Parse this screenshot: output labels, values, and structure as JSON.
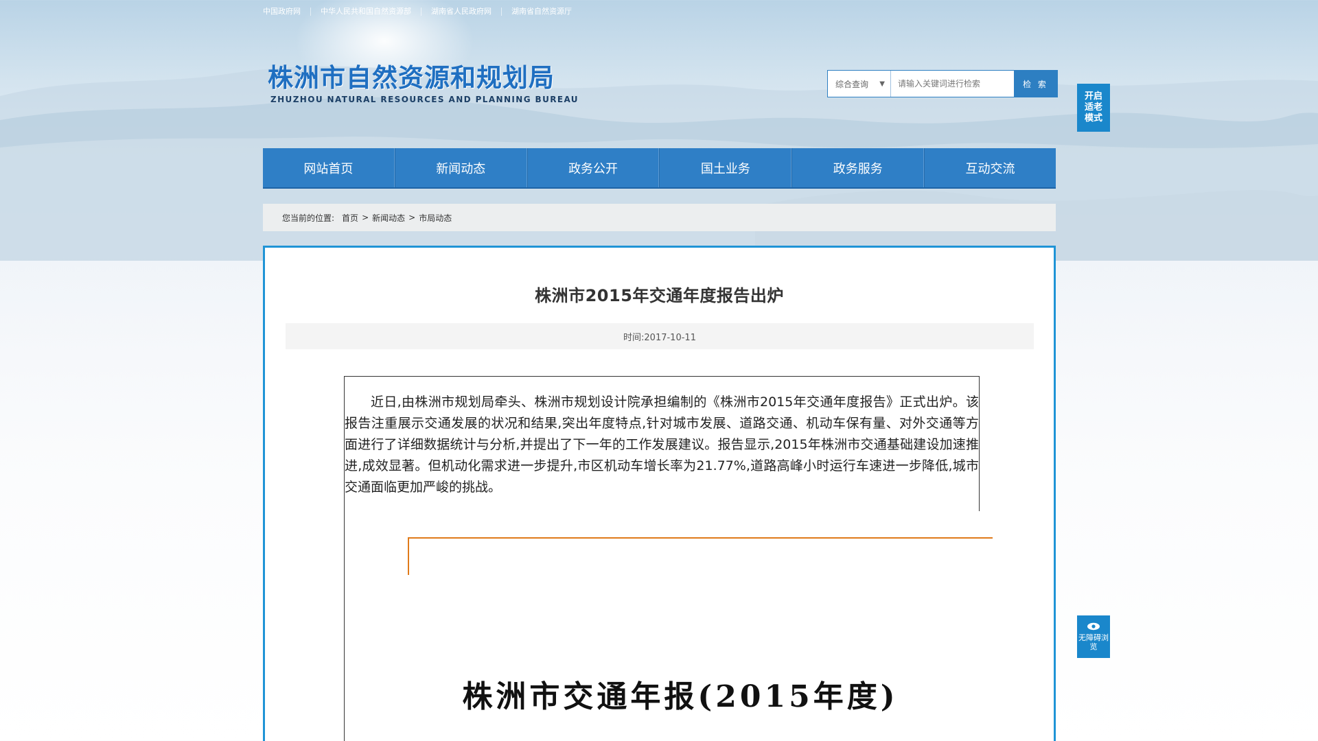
{
  "top_links": [
    {
      "label": "中国政府网"
    },
    {
      "label": "中华人民共和国自然资源部"
    },
    {
      "label": "湖南省人民政府网"
    },
    {
      "label": "湖南省自然资源厅"
    }
  ],
  "header": {
    "logo_cn": "株洲市自然资源和规划局",
    "logo_en": "ZHUZHOU NATURAL RESOURCES AND PLANNING BUREAU"
  },
  "search": {
    "select_value": "综合查询",
    "placeholder": "请输入关键词进行检索",
    "button_label": "检 索"
  },
  "side_buttons": {
    "elder_mode": "开启适老模式",
    "accessibility": "无障碍浏览",
    "accessibility_icon": "eye-icon"
  },
  "nav": {
    "items": [
      {
        "label": "网站首页"
      },
      {
        "label": "新闻动态"
      },
      {
        "label": "政务公开"
      },
      {
        "label": "国土业务"
      },
      {
        "label": "政务服务"
      },
      {
        "label": "互动交流"
      }
    ]
  },
  "breadcrumb": {
    "label": "您当前的位置:",
    "items": [
      "首页",
      "新闻动态",
      "市局动态"
    ],
    "separator": ">"
  },
  "article": {
    "title": "株洲市2015年交通年度报告出炉",
    "meta": "时间:2017-10-11",
    "body": "近日,由株洲市规划局牵头、株洲市规划设计院承担编制的《株洲市2015年交通年度报告》正式出炉。该报告注重展示交通发展的状况和结果,突出年度特点,针对城市发展、道路交通、机动车保有量、对外交通等方面进行了详细数据统计与分析,并提出了下一年的工作发展建议。报告显示,2015年株洲市交通基础建设加速推进,成效显著。但机动化需求进一步提升,市区机动车增长率为21.77%,道路高峰小时运行车速进一步降低,城市交通面临更加严峻的挑战。",
    "report_title": "株洲市交通年报(2015年度)"
  },
  "colors": {
    "brand_blue": "#2f7fc6",
    "content_border": "#1f94d6",
    "accent_orange": "#e07a1a"
  }
}
